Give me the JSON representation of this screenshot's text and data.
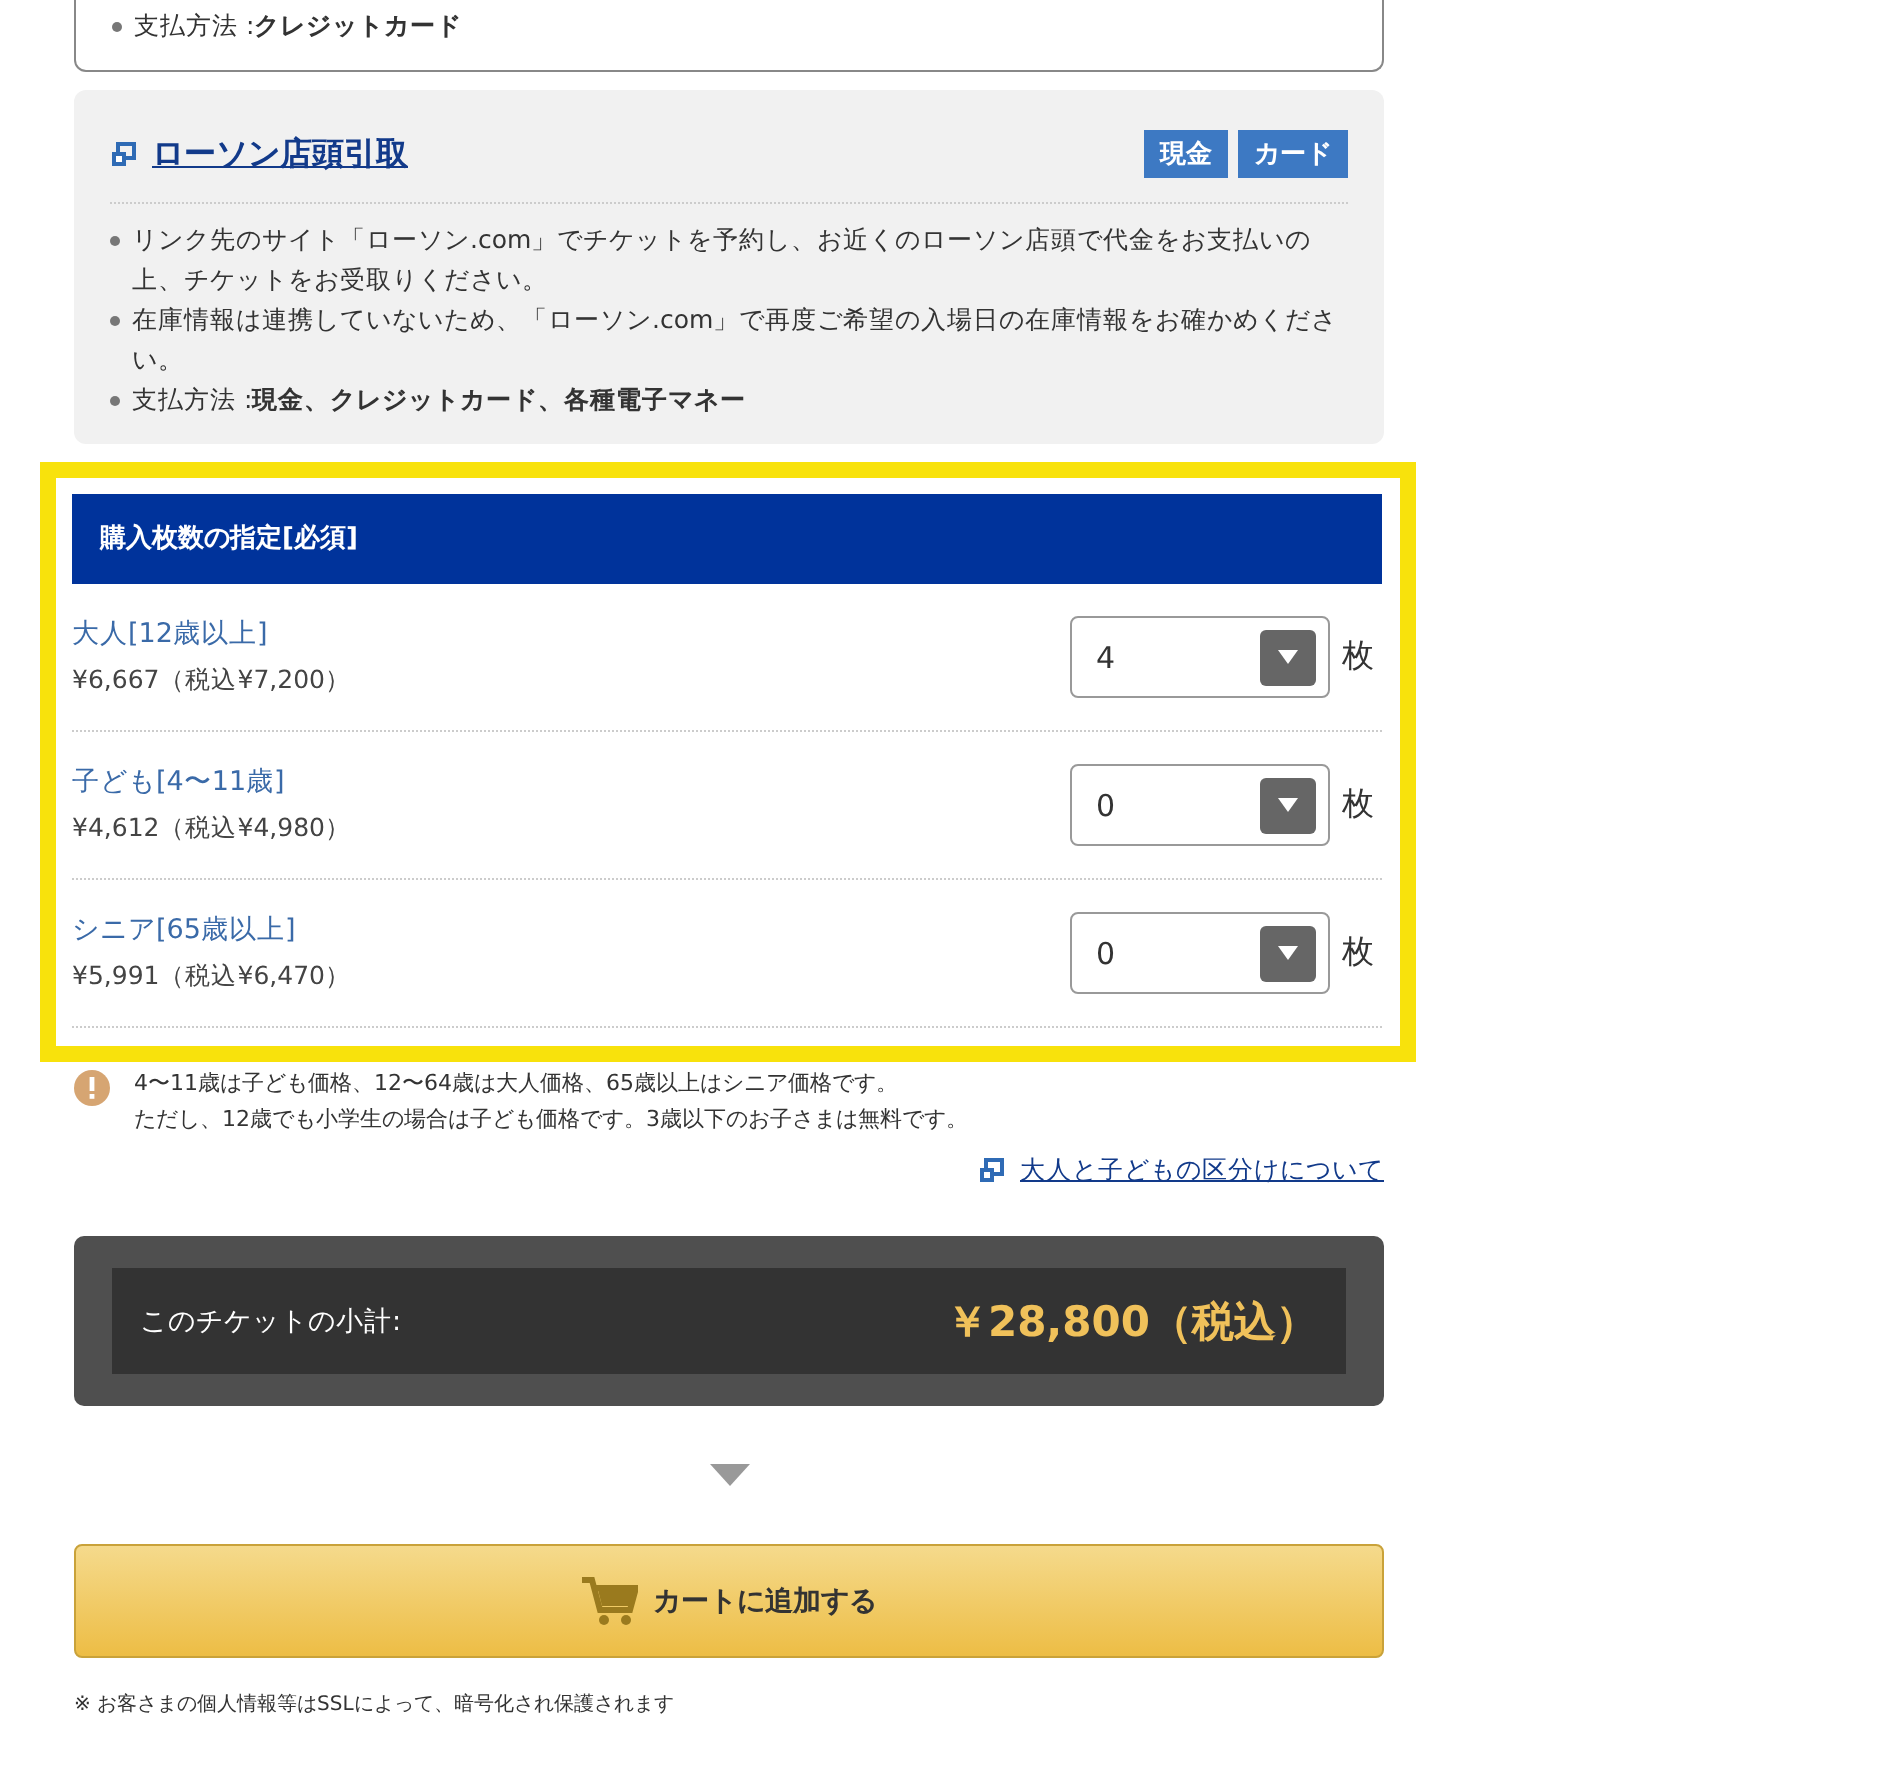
{
  "prev_method": {
    "bullets": [
      "支払方法 :**クレジットカード**"
    ]
  },
  "lawson": {
    "title": "ローソン店頭引取",
    "badges": [
      "現金",
      "カード"
    ],
    "bullets": [
      "リンク先のサイト「ローソン.com」でチケットを予約し、お近くのローソン店頭で代金をお支払いの上、チケットをお受取りください。",
      "在庫情報は連携していないため、「ローソン.com」で再度ご希望の入場日の在庫情報をお確かめください。",
      "支払方法 :**現金、クレジットカード、各種電子マネー**"
    ]
  },
  "quantity": {
    "highlighted": true,
    "header": "購入枚数の指定[必須]",
    "rows": [
      {
        "label": "大人[12歳以上]",
        "price": "¥6,667（税込¥7,200）",
        "value": "4",
        "unit": "枚"
      },
      {
        "label": "子ども[4〜11歳]",
        "price": "¥4,612（税込¥4,980）",
        "value": "0",
        "unit": "枚"
      },
      {
        "label": "シニア[65歳以上]",
        "price": "¥5,991（税込¥6,470）",
        "value": "0",
        "unit": "枚"
      }
    ]
  },
  "notice": [
    "4〜11歳は子ども価格、12〜64歳は大人価格、65歳以上はシニア価格です。",
    "ただし、12歳でも小学生の場合は子ども価格です。3歳以下のお子さまは無料です。"
  ],
  "age_link": "大人と子どもの区分けについて",
  "subtotal": {
    "label": "このチケットの小計:",
    "amount": "￥28,800（税込）"
  },
  "add_to_cart": "カートに追加する",
  "footnote": "※ お客さまの個人情報等はSSLによって、暗号化され保護されます"
}
